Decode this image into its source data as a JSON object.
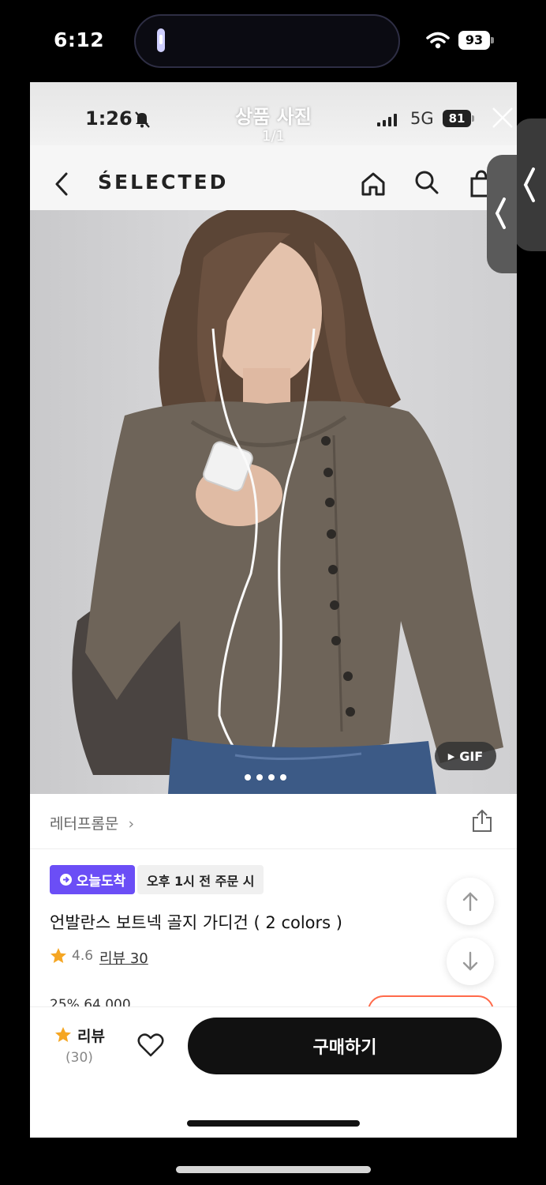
{
  "outer_status": {
    "time": "6:12",
    "battery": "93"
  },
  "viewer": {
    "title": "상품 사진",
    "counter": "1/1",
    "inner_status": {
      "time": "1:26",
      "network": "5G",
      "battery": "81"
    }
  },
  "app_nav": {
    "brand": "ŚELECTED"
  },
  "photo": {
    "gif_label": "GIF",
    "carousel_dots": 4
  },
  "product": {
    "seller": "레터프롬문",
    "today_badge": "오늘도착",
    "order_note": "오후 1시 전 주문 시",
    "name": "언발란스 보트넥 골지 가디건 ( 2 colors )",
    "rating": "4.6",
    "review_link": "리뷰 30",
    "price_partial": "25% 64,000"
  },
  "bottom_bar": {
    "review_label": "리뷰",
    "review_count": "(30)",
    "buy_label": "구매하기"
  },
  "colors": {
    "accent_purple": "#6b4ef6",
    "buy_button": "#111111",
    "star": "#f5a623",
    "coupon_border": "#ff6a4a"
  }
}
